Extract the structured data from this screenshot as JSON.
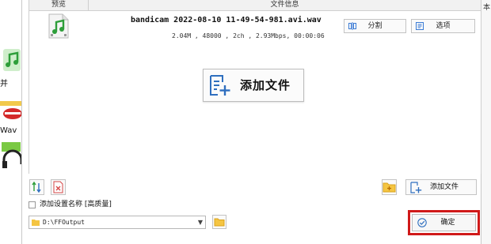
{
  "background_app": {
    "labels": [
      "并",
      "Wav"
    ],
    "right_edge_text": "本"
  },
  "dialog": {
    "table": {
      "header_preview": "预览",
      "header_file_info": "文件信息",
      "rows": [
        {
          "file_name": "bandicam 2022-08-10 11-49-54-981.avi.wav",
          "meta": "2.04M , 48000 , 2ch , 2.93Mbps, 00:00:06",
          "split_label": "分割",
          "options_label": "选项"
        }
      ]
    },
    "big_add_label": "添加文件",
    "add_file_label": "添加文件",
    "rename_label": "添加设置名称 [高质量]",
    "output_path": "D:\\FFOutput",
    "ok_label": "确定",
    "accent_color": "#3a7bd5",
    "highlight_color": "#d01919"
  }
}
